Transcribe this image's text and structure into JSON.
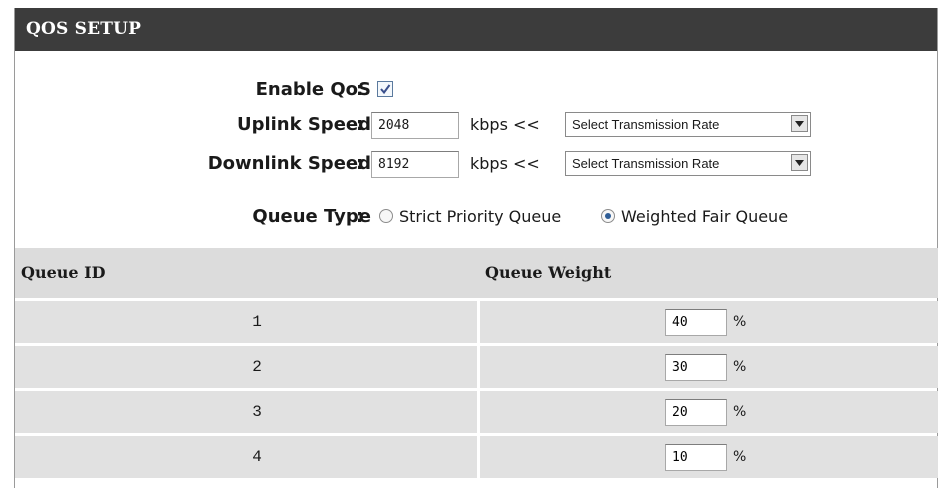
{
  "section": {
    "title": "QOS SETUP"
  },
  "form": {
    "colon": ":",
    "enable_qos": {
      "label": "Enable QoS",
      "checked": true
    },
    "uplink": {
      "label": "Uplink Speed",
      "value": "2048",
      "unit": "kbps <<",
      "select_value": "Select Transmission Rate"
    },
    "downlink": {
      "label": "Downlink Speed",
      "value": "8192",
      "unit": "kbps <<",
      "select_value": "Select Transmission Rate"
    },
    "queue_type": {
      "label": "Queue Type",
      "options": [
        {
          "label": "Strict Priority Queue",
          "selected": false
        },
        {
          "label": "Weighted Fair Queue",
          "selected": true
        }
      ]
    }
  },
  "table": {
    "headers": [
      "Queue ID",
      "Queue Weight"
    ],
    "unit": "%",
    "rows": [
      {
        "id": "1",
        "weight": "40"
      },
      {
        "id": "2",
        "weight": "30"
      },
      {
        "id": "3",
        "weight": "20"
      },
      {
        "id": "4",
        "weight": "10"
      }
    ]
  },
  "colors": {
    "header_bg": "#3c3c3c",
    "row_bg": "#e1e1e1",
    "radio_dot": "#2f5d96"
  },
  "icons": {
    "checkbox": "checkmark-icon",
    "dropdown": "chevron-down-icon"
  }
}
